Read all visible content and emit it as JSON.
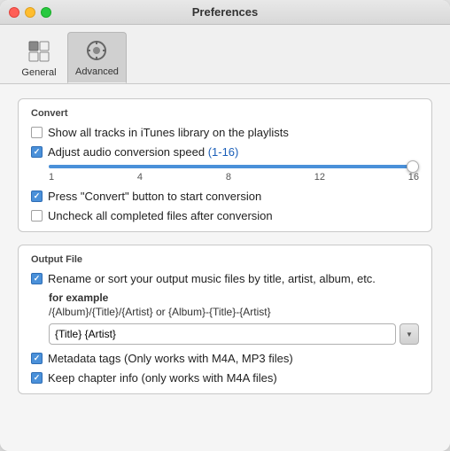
{
  "window": {
    "title": "Preferences"
  },
  "toolbar": {
    "buttons": [
      {
        "id": "general",
        "label": "General",
        "active": false
      },
      {
        "id": "advanced",
        "label": "Advanced",
        "active": true
      }
    ]
  },
  "convert_section": {
    "header": "Convert",
    "items": [
      {
        "id": "show-all-tracks",
        "label": "Show all tracks in iTunes library on the playlists",
        "checked": false
      },
      {
        "id": "adjust-audio-speed",
        "label": "Adjust audio conversion speed (1-16)",
        "checked": true
      },
      {
        "id": "press-convert",
        "label": "Press \"Convert\" button to start conversion",
        "checked": true
      },
      {
        "id": "uncheck-completed",
        "label": "Uncheck all completed files after conversion",
        "checked": false
      }
    ],
    "slider": {
      "labels": [
        "1",
        "4",
        "8",
        "12",
        "16"
      ],
      "value": 16
    }
  },
  "output_section": {
    "header": "Output File",
    "rename_checked": true,
    "rename_label": "Rename or sort your output music files by title, artist, album, etc.",
    "example_label": "for example",
    "example_path": "/{Album}/{Title}/{Artist} or {Album}-{Title}-{Artist}",
    "input_value": "{Title} {Artist}",
    "input_placeholder": "{Title} {Artist}",
    "metadata_checked": true,
    "metadata_label": "Metadata tags (Only works with M4A, MP3 files)",
    "chapter_checked": true,
    "chapter_label": "Keep chapter info (only works with  M4A files)"
  }
}
